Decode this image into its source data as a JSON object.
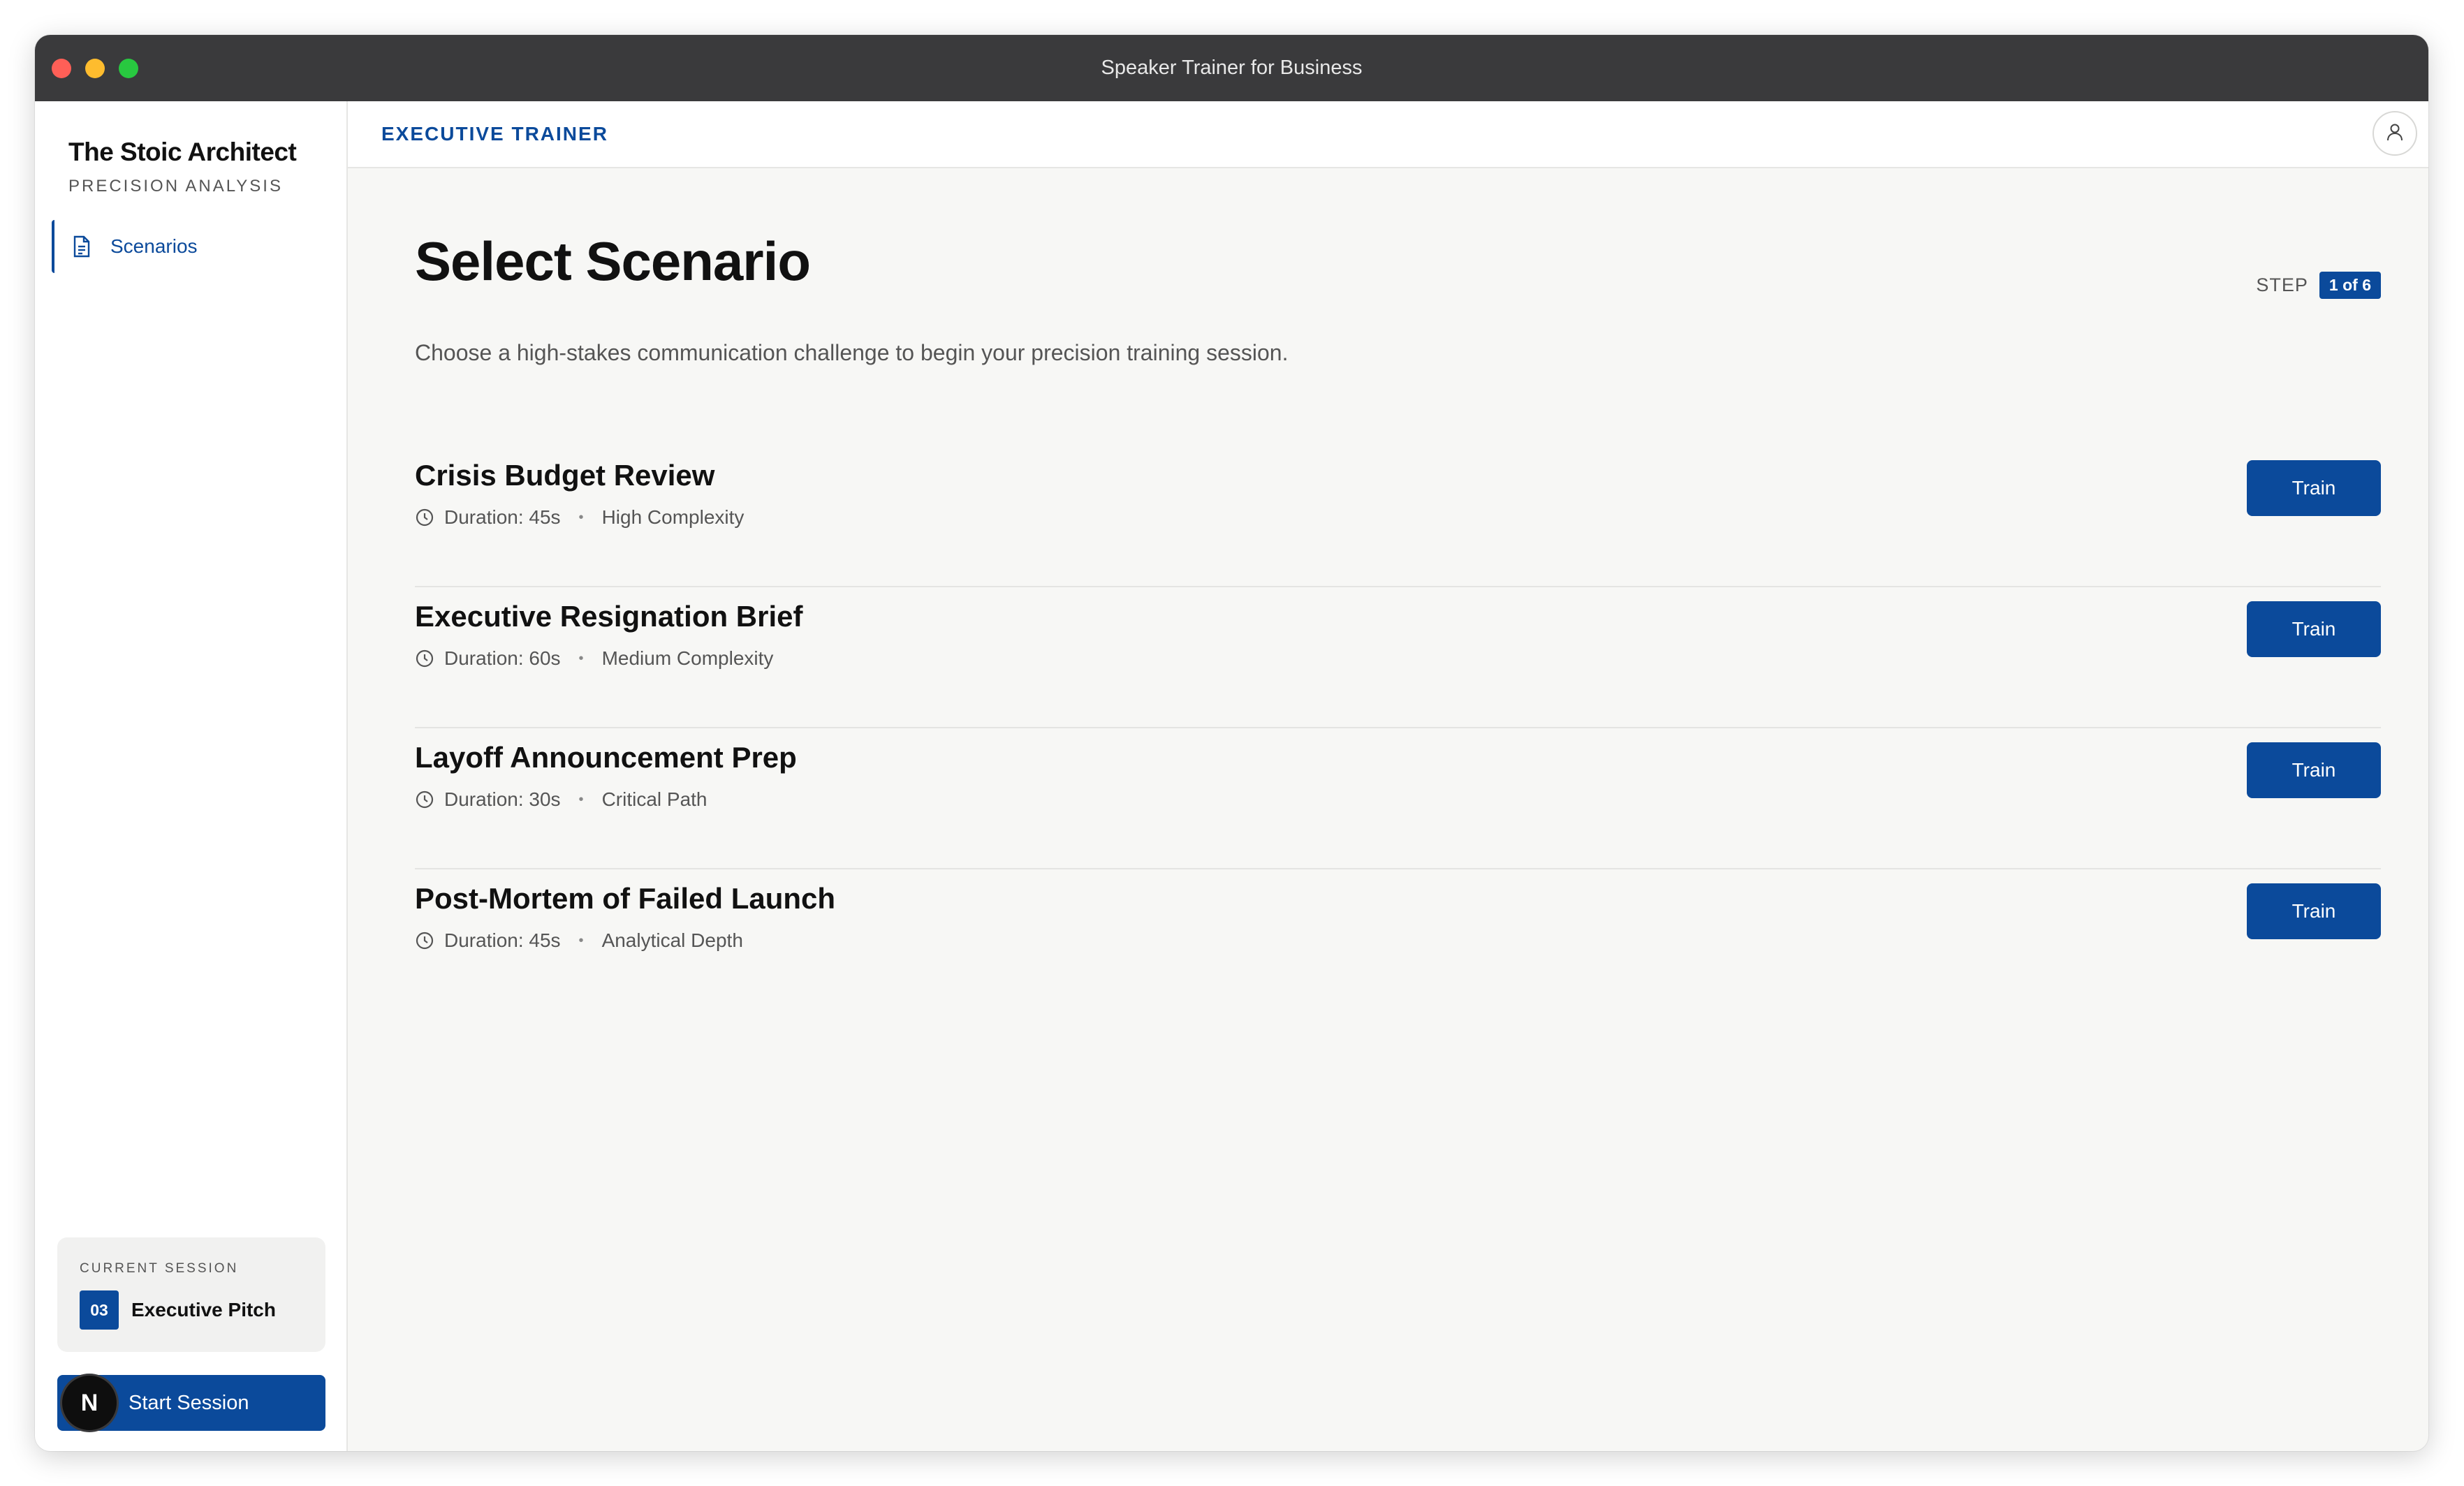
{
  "window": {
    "title": "Speaker Trainer for Business"
  },
  "sidebar": {
    "brand_title": "The Stoic Architect",
    "brand_subtitle": "PRECISION ANALYSIS",
    "nav": [
      {
        "label": "Scenarios",
        "icon": "document-icon",
        "active": true
      }
    ],
    "current_session": {
      "label": "CURRENT SESSION",
      "number": "03",
      "name": "Executive Pitch"
    },
    "start_button": "Start Session",
    "badge_letter": "N"
  },
  "topbar": {
    "title": "EXECUTIVE TRAINER",
    "avatar_icon": "user-icon"
  },
  "main": {
    "title": "Select Scenario",
    "description": "Choose a high-stakes communication challenge to begin your precision training session.",
    "step_label": "STEP",
    "step_value": "1 of 6",
    "scenarios": [
      {
        "title": "Crisis Budget Review",
        "duration": "Duration: 45s",
        "tag": "High Complexity",
        "button": "Train"
      },
      {
        "title": "Executive Resignation Brief",
        "duration": "Duration: 60s",
        "tag": "Medium Complexity",
        "button": "Train"
      },
      {
        "title": "Layoff Announcement Prep",
        "duration": "Duration: 30s",
        "tag": "Critical Path",
        "button": "Train"
      },
      {
        "title": "Post-Mortem of Failed Launch",
        "duration": "Duration: 45s",
        "tag": "Analytical Depth",
        "button": "Train"
      }
    ]
  },
  "colors": {
    "accent": "#0b4a9b",
    "titlebar": "#3a3a3c",
    "background": "#f7f7f5"
  }
}
